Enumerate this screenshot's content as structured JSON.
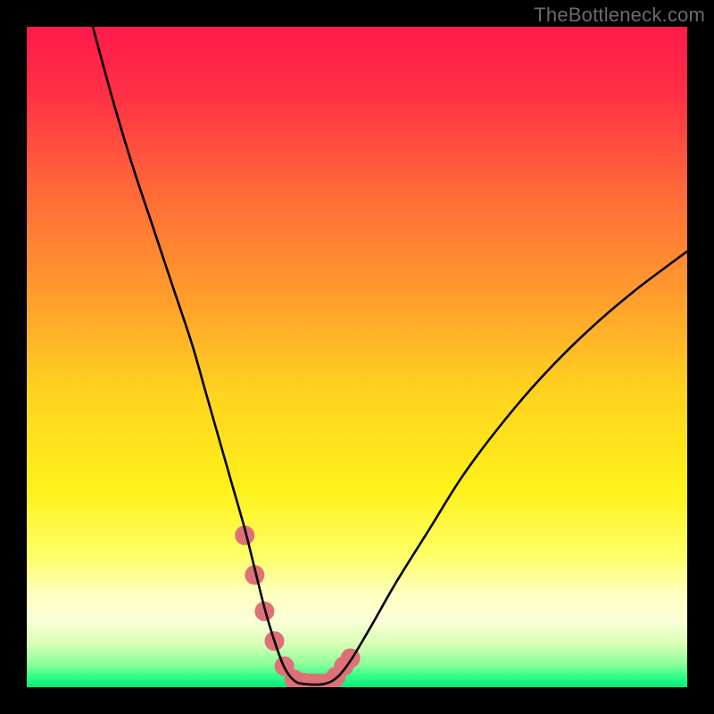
{
  "watermark": "TheBottleneck.com",
  "chart_data": {
    "type": "line",
    "title": "",
    "xlabel": "",
    "ylabel": "",
    "xlim": [
      0,
      100
    ],
    "ylim": [
      0,
      100
    ],
    "gradient_stops": [
      {
        "pos": 0.0,
        "color": "#ff1a4b"
      },
      {
        "pos": 0.1,
        "color": "#ff2f45"
      },
      {
        "pos": 0.25,
        "color": "#ff6a38"
      },
      {
        "pos": 0.4,
        "color": "#ff9a2e"
      },
      {
        "pos": 0.55,
        "color": "#ffd21f"
      },
      {
        "pos": 0.7,
        "color": "#fff11a"
      },
      {
        "pos": 0.8,
        "color": "#ffff66"
      },
      {
        "pos": 0.86,
        "color": "#ffffc0"
      },
      {
        "pos": 0.9,
        "color": "#faffd8"
      },
      {
        "pos": 0.935,
        "color": "#d7ffb4"
      },
      {
        "pos": 0.965,
        "color": "#8cff9a"
      },
      {
        "pos": 0.985,
        "color": "#2bff88"
      },
      {
        "pos": 1.0,
        "color": "#09e877"
      }
    ],
    "series": [
      {
        "name": "bottleneck-curve",
        "x": [
          10,
          13,
          16,
          19,
          22,
          25,
          27,
          29,
          31,
          33,
          34.5,
          36,
          37.5,
          39,
          40.5,
          42,
          45,
          47,
          49,
          52,
          56,
          61,
          66,
          72,
          78,
          85,
          92,
          100
        ],
        "y": [
          100,
          89,
          79,
          70,
          61,
          52,
          45,
          38,
          31,
          24,
          18,
          12,
          7,
          3,
          1,
          0.5,
          0.5,
          1.5,
          4,
          9,
          16,
          24,
          32,
          40,
          47,
          54,
          60,
          66
        ]
      }
    ],
    "markers": {
      "name": "highlight-band",
      "color": "#e07078",
      "x": [
        33.0,
        34.5,
        36.0,
        37.5,
        39.0,
        40.5,
        42.0,
        43.2,
        44.0,
        45.0,
        46.0,
        46.8,
        48.0,
        49.0
      ],
      "y": [
        23,
        17,
        11.5,
        7,
        3.2,
        1.2,
        0.7,
        0.6,
        0.6,
        0.6,
        0.8,
        1.6,
        3.2,
        4.4
      ],
      "radius": 11
    }
  }
}
